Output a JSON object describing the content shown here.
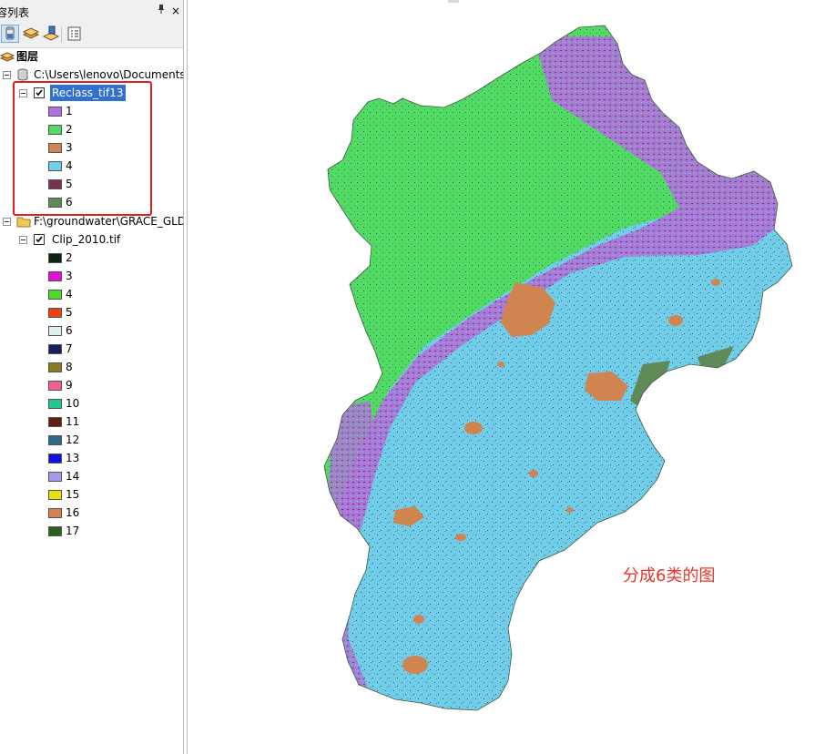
{
  "toc": {
    "title": "容列表",
    "pin_glyph": "ᵖ",
    "close_glyph": "×",
    "toolbar": {
      "buttons": [
        "list-by-drawing-order-icon",
        "list-by-source-icon",
        "list-by-visibility-icon",
        "options-icon"
      ]
    },
    "layers_root": "图层",
    "groups": [
      {
        "path": "C:\\Users\\lenovo\\Documents",
        "layer": {
          "name": "Reclass_tif13",
          "checked": true,
          "selected": true,
          "classes": [
            {
              "label": "1",
              "color": "#b070e0"
            },
            {
              "label": "2",
              "color": "#50dc64"
            },
            {
              "label": "3",
              "color": "#d08550"
            },
            {
              "label": "4",
              "color": "#6ecfea"
            },
            {
              "label": "5",
              "color": "#7a3050"
            },
            {
              "label": "6",
              "color": "#5f8a58"
            }
          ]
        }
      },
      {
        "path": "F:\\groundwater\\GRACE_GLD",
        "layer": {
          "name": "Clip_2010.tif",
          "checked": true,
          "selected": false,
          "classes": [
            {
              "label": "2",
              "color": "#0d2413"
            },
            {
              "label": "3",
              "color": "#e010d8"
            },
            {
              "label": "4",
              "color": "#4cdc28"
            },
            {
              "label": "5",
              "color": "#f04010"
            },
            {
              "label": "6",
              "color": "#dff0f2"
            },
            {
              "label": "7",
              "color": "#152060"
            },
            {
              "label": "8",
              "color": "#8a7a20"
            },
            {
              "label": "9",
              "color": "#f06090"
            },
            {
              "label": "10",
              "color": "#20c890"
            },
            {
              "label": "11",
              "color": "#602010"
            },
            {
              "label": "12",
              "color": "#2a6a8a"
            },
            {
              "label": "13",
              "color": "#1010e0"
            },
            {
              "label": "14",
              "color": "#a898f0"
            },
            {
              "label": "15",
              "color": "#e8e010"
            },
            {
              "label": "16",
              "color": "#d88050"
            },
            {
              "label": "17",
              "color": "#2a6020"
            }
          ]
        }
      }
    ]
  },
  "map": {
    "annotation": "分成6类的图",
    "colors": {
      "forest": "#50dc64",
      "cropland": "#6ecfea",
      "purple": "#b070e0",
      "urban": "#d08550",
      "speckle": "#7a3050",
      "wetland": "#5f8a58"
    }
  }
}
